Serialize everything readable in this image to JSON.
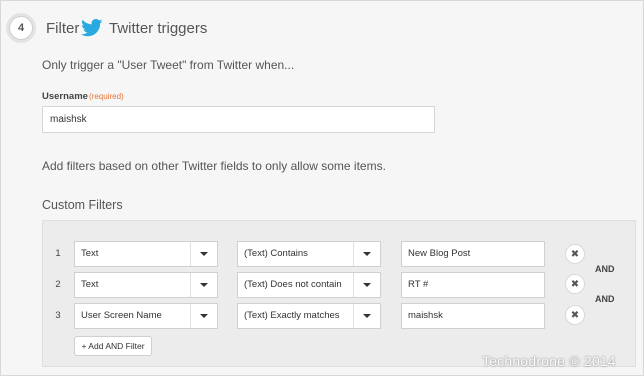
{
  "header": {
    "step_number": "4",
    "title": "Filter",
    "service_icon": "twitter-bird-icon",
    "subtitle": "Twitter triggers"
  },
  "intro": "Only trigger a \"User Tweet\" from Twitter when...",
  "username": {
    "label": "Username",
    "required_text": "(required)",
    "value": "maishsk"
  },
  "help_text": "Add filters based on other Twitter fields to only allow some items.",
  "custom_filters": {
    "title": "Custom Filters",
    "rows": [
      {
        "num": "1",
        "field": "Text",
        "operator": "(Text) Contains",
        "value": "New Blog Post"
      },
      {
        "num": "2",
        "field": "Text",
        "operator": "(Text) Does not contain",
        "value": "RT #"
      },
      {
        "num": "3",
        "field": "User Screen Name",
        "operator": "(Text) Exactly matches",
        "value": "maishsk"
      }
    ],
    "and_labels": [
      "AND",
      "AND"
    ],
    "remove_symbol": "✖",
    "add_button": "+ Add AND Filter"
  },
  "watermark": "Technodrone © 2014",
  "colors": {
    "twitter_blue": "#2aa9e0",
    "required_orange": "#e8743b"
  }
}
